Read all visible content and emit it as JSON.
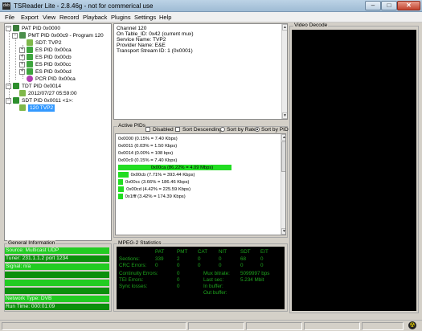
{
  "window": {
    "app_icon": "dvb",
    "title": "TSReader Lite - 2.8.46g - not for commerical use",
    "minimize": "–",
    "maximize": "□",
    "close": "✕"
  },
  "menu": [
    "File",
    "Export",
    "View",
    "Record",
    "Playback",
    "Plugins",
    "Settings",
    "Help"
  ],
  "tree": {
    "pat": "PAT PID 0x0000",
    "pmt": "PMT PID 0x00c9 - Program 120",
    "sdt_ref": "SDT: TVP2",
    "es": [
      "ES PID 0x00ca",
      "ES PID 0x00cb",
      "ES PID 0x00cc",
      "ES PID 0x00cd"
    ],
    "pcr": "PCR PID 0x00ca",
    "tdt": "TDT PID 0x0014",
    "tdt_time": "2012/07/27 05:59:00",
    "sdt": "SDT PID 0x0011 <1>:",
    "sdt_service": "120 TVP2"
  },
  "details": [
    "Channel 120",
    "On Table_ID: 0x42 (current mux)",
    "Service Name: TVP2",
    "Provider Name: E&E",
    "Transport Stream ID: 1 (0x0001)"
  ],
  "active_pids": {
    "label": "Active PIDs",
    "options": {
      "disabled": "Disabled",
      "sort_descending": "Sort Descending",
      "sort_by_rate": "Sort by Rate",
      "sort_by_pid": "Sort by PID"
    },
    "rows": [
      {
        "text": "0x0000 (0.15% = 7.40 Kbps)",
        "share": 0.15
      },
      {
        "text": "0x0011 (0.03% = 1.50 Kbps)",
        "share": 0.03
      },
      {
        "text": "0x0014 (0.00% = 108 bps)",
        "share": 0.0
      },
      {
        "text": "0x00c9 (0.15% = 7.40 Kbps)",
        "share": 0.15
      },
      {
        "text": "0x00ca (86.22% = 4.09 Mbps)",
        "share": 86.22
      },
      {
        "text": "0x00cb (7.71% = 393.44 Kbps)",
        "share": 7.71
      },
      {
        "text": "0x00cc (3.66% = 186.46 Kbps)",
        "share": 3.66
      },
      {
        "text": "0x00cd (4.42% = 225.59 Kbps)",
        "share": 4.42
      },
      {
        "text": "0x1fff (3.42% = 174.39 Kbps)",
        "share": 3.42
      }
    ]
  },
  "general_info": {
    "label": "General Information",
    "rows": [
      {
        "text": "Source: Multicast UDP",
        "shade": "light"
      },
      {
        "text": "Tuner: 231.1.1.2 port 1234",
        "shade": "dark"
      },
      {
        "text": "Signal: n/a",
        "shade": "light"
      },
      {
        "text": "",
        "shade": "dark"
      },
      {
        "text": "",
        "shade": "light"
      },
      {
        "text": "",
        "shade": "dark"
      },
      {
        "text": "Network Type: DVB",
        "shade": "light"
      },
      {
        "text": "Run Time: 000:01:09",
        "shade": "dark"
      }
    ]
  },
  "mpeg2": {
    "label": "MPEG-2 Statistics",
    "headers": [
      "PAT",
      "PMT",
      "CAT",
      "NIT",
      "SDT",
      "EIT"
    ],
    "sections_label": "Sections:",
    "sections": [
      "339",
      "2",
      "0",
      "0",
      "68",
      "0"
    ],
    "crc_label": "CRC Errors:",
    "crc": [
      "0",
      "0",
      "0",
      "0",
      "0",
      "0"
    ],
    "continuity_label": "Continuity Errors:",
    "continuity": "0",
    "tei_label": "TEI Errors:",
    "tei": "0",
    "sync_label": "Sync losses:",
    "sync": "0",
    "mux_bitrate_label": "Mux bitrate:",
    "mux_bitrate": "5099997 bps",
    "last_sec_label": "Last sec:",
    "last_sec": "5.234 Mbit",
    "in_buffer_label": "In buffer:",
    "out_buffer_label": "Out buffer:"
  },
  "video": {
    "label": "Video Decode"
  },
  "status": {
    "icon": "☢"
  }
}
